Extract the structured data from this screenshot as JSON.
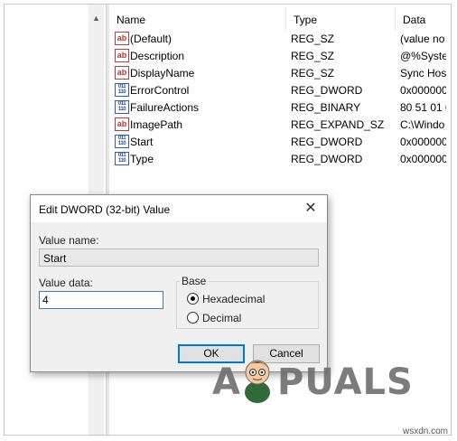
{
  "registry": {
    "columns": {
      "name": "Name",
      "type": "Type",
      "data": "Data"
    },
    "values": [
      {
        "icon": "string",
        "name": "(Default)",
        "type": "REG_SZ",
        "data": "(value no"
      },
      {
        "icon": "string",
        "name": "Description",
        "type": "REG_SZ",
        "data": "@%Syste"
      },
      {
        "icon": "string",
        "name": "DisplayName",
        "type": "REG_SZ",
        "data": "Sync Hos"
      },
      {
        "icon": "binary",
        "name": "ErrorControl",
        "type": "REG_DWORD",
        "data": "0x000000"
      },
      {
        "icon": "binary",
        "name": "FailureActions",
        "type": "REG_BINARY",
        "data": "80 51 01 0"
      },
      {
        "icon": "string",
        "name": "ImagePath",
        "type": "REG_EXPAND_SZ",
        "data": "C:\\Windo"
      },
      {
        "icon": "binary",
        "name": "Start",
        "type": "REG_DWORD",
        "data": "0x000000"
      },
      {
        "icon": "binary",
        "name": "Type",
        "type": "REG_DWORD",
        "data": "0x000000"
      }
    ]
  },
  "dialog": {
    "title": "Edit DWORD (32-bit) Value",
    "value_name_label": "Value name:",
    "value_name": "Start",
    "value_data_label": "Value data:",
    "value_data": "4",
    "base_label": "Base",
    "radio_hex": "Hexadecimal",
    "radio_dec": "Decimal",
    "selected_base": "Hexadecimal",
    "ok_label": "OK",
    "cancel_label": "Cancel"
  },
  "watermark": {
    "text_a": "A",
    "text_rest": "PUALS",
    "site": "wsxdn.com"
  },
  "icons": {
    "string_icon_text": "ab",
    "binary_icon_text": "011 110"
  }
}
